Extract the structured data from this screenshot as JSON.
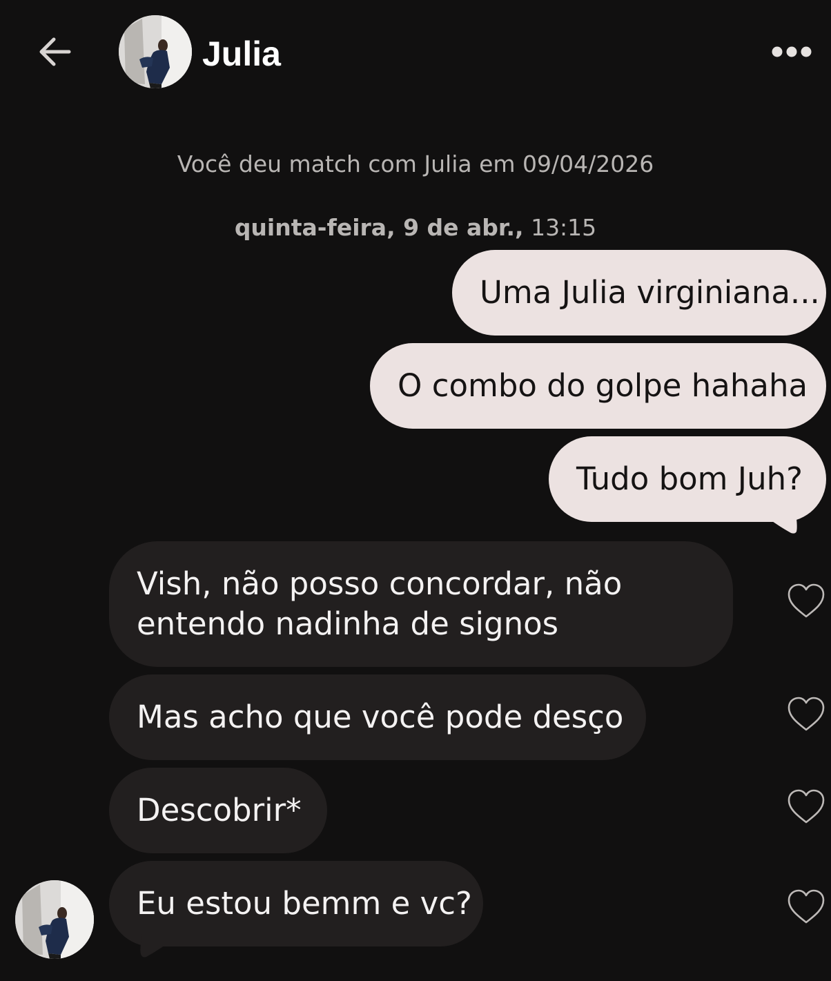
{
  "header": {
    "name": "Julia"
  },
  "match_notice": "Você deu match com Julia em 09/04/2026",
  "day_stamp": {
    "day": "quinta-feira, 9 de abr.,",
    "time": " 13:15"
  },
  "messages_sent": [
    {
      "text": "Uma Julia virginiana..."
    },
    {
      "text": "O combo do golpe hahaha"
    },
    {
      "text": "Tudo bom Juh?"
    }
  ],
  "messages_received": [
    {
      "text": "Vish, não posso concordar, não entendo nadinha de signos"
    },
    {
      "text": "Mas acho que você pode desço"
    },
    {
      "text": "Descobrir*"
    },
    {
      "text": "Eu estou bemm e vc?"
    }
  ],
  "colors": {
    "background": "#111010",
    "sent_bubble": "#ece2e1",
    "received_bubble": "#221f1f",
    "muted_text": "#b9b6b4"
  },
  "icons": {
    "back": "arrow-left-icon",
    "more": "more-horizontal-icon",
    "like": "heart-outline-icon"
  }
}
